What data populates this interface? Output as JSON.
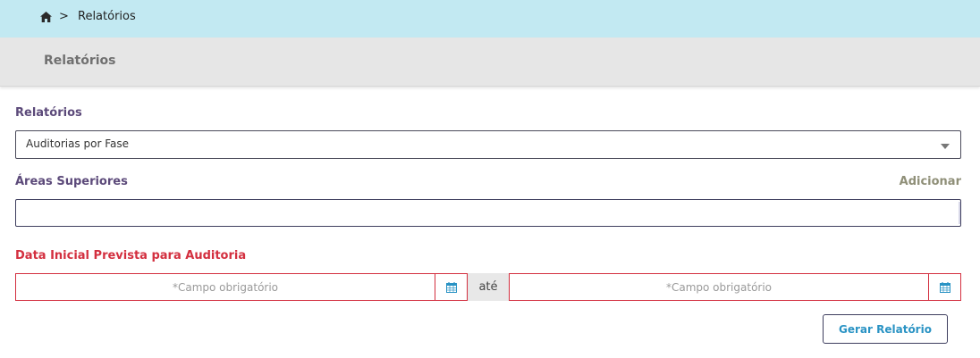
{
  "breadcrumb": {
    "home_icon": "home-icon",
    "separator": ">",
    "current": "Relatórios"
  },
  "page": {
    "title": "Relatórios"
  },
  "form": {
    "report": {
      "label": "Relatórios",
      "selected": "Auditorias por Fase"
    },
    "areas": {
      "label": "Áreas Superiores",
      "add_label": "Adicionar",
      "value": ""
    },
    "date_range": {
      "label": "Data Inicial Prevista para Auditoria",
      "start_placeholder": "*Campo obrigatório",
      "separator": "até",
      "end_placeholder": "*Campo obrigatório",
      "calendar_icon": "calendar-icon"
    },
    "submit_label": "Gerar Relatório"
  },
  "colors": {
    "breadcrumb_bg": "#c2e9f2",
    "title_bar_bg": "#e6e6e6",
    "label_purple": "#5c4a7a",
    "required_red": "#d32f3f",
    "button_text": "#2a93c4",
    "add_link": "#8f8f78"
  }
}
